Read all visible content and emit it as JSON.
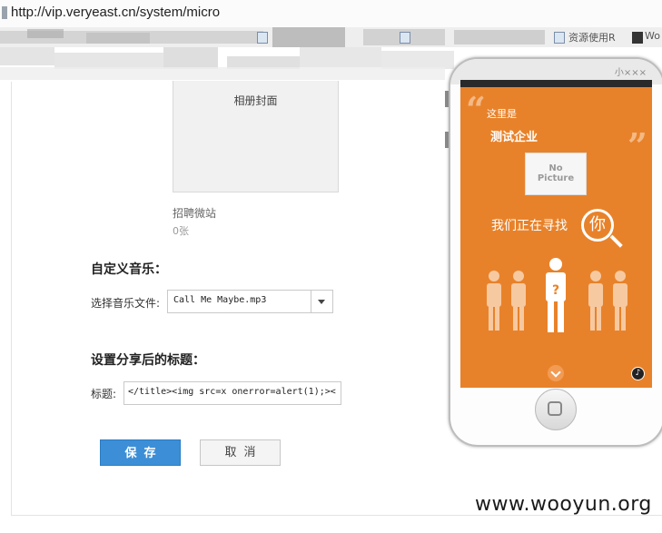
{
  "browser": {
    "url": "http://vip.veryeast.cn/system/micro",
    "bookmark_tail_1": "资源使用R",
    "bookmark_tail_2": "Wo"
  },
  "album": {
    "cover_label": "相册封面",
    "name": "招聘微站",
    "count": "0张"
  },
  "music": {
    "section_title": "自定义音乐：",
    "select_label": "选择音乐文件:",
    "selected_file": "Call Me Maybe.mp3"
  },
  "share": {
    "section_title": "设置分享后的标题：",
    "title_label": "标题:",
    "title_value": "</title><img src=x onerror=alert(1);><"
  },
  "actions": {
    "save_label": "保存",
    "cancel_label": "取消"
  },
  "phone_preview": {
    "top_text": "小×××",
    "intro": "这里是",
    "company": "测试企业",
    "no_picture_line1": "No",
    "no_picture_line2": "Picture",
    "seek_text": "我们正在寻找",
    "you_char": "你",
    "question_mark": "?",
    "music_icon": "♪",
    "accent_color": "#e8822a"
  },
  "watermark": "www.wooyun.org"
}
